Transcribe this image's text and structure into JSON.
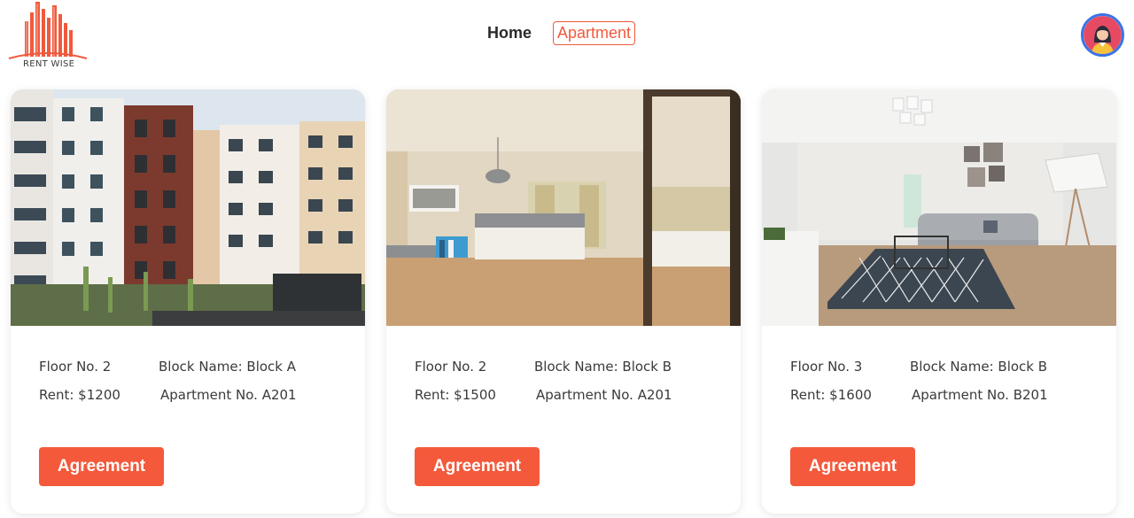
{
  "brand": {
    "name": "RENT WISE",
    "accent": "#f4593b"
  },
  "nav": {
    "home": "Home",
    "apartment": "Apartment",
    "active": "Apartment"
  },
  "profile": {
    "icon": "user-avatar-icon"
  },
  "apartments": [
    {
      "image": "apartment-building-exterior",
      "floor": "Floor No. 2",
      "block": "Block Name: Block A",
      "rent": "Rent: $1200",
      "apartment_no": "Apartment No. A201",
      "button": "Agreement"
    },
    {
      "image": "hotel-style-bedroom",
      "floor": "Floor No. 2",
      "block": "Block Name: Block B",
      "rent": "Rent: $1500",
      "apartment_no": "Apartment No. A201",
      "button": "Agreement"
    },
    {
      "image": "living-room-interior",
      "floor": "Floor No. 3",
      "block": "Block Name: Block B",
      "rent": "Rent: $1600",
      "apartment_no": "Apartment No. B201",
      "button": "Agreement"
    }
  ]
}
